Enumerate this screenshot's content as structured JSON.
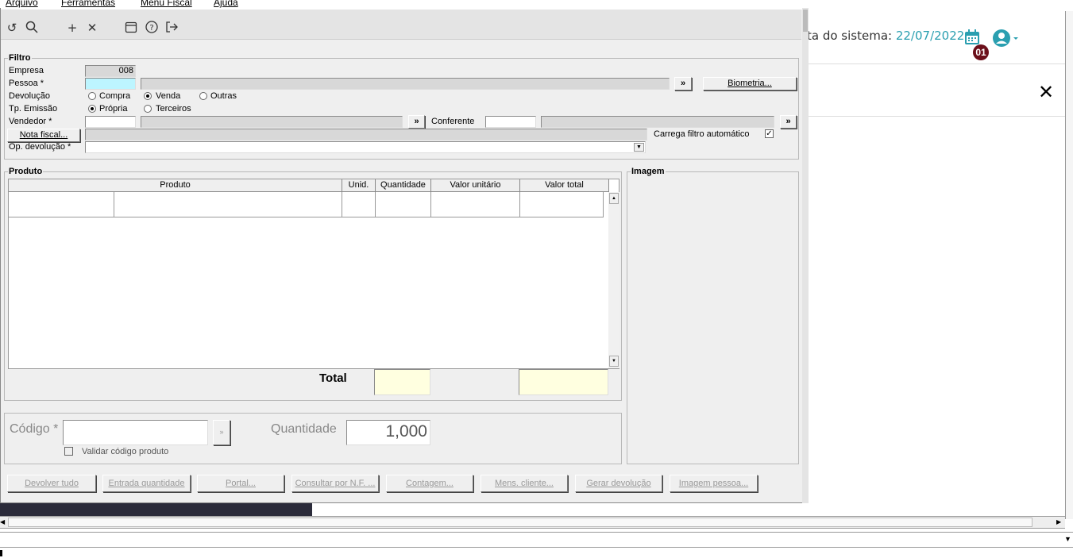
{
  "menu": {
    "items": [
      "Arquivo",
      "Ferramentas",
      "Menu Fiscal",
      "Ajuda"
    ]
  },
  "toolbar": {
    "icons": [
      "undo-icon",
      "search-icon",
      "plus-icon",
      "x-icon",
      "calendar-icon",
      "help-icon",
      "exit-icon"
    ]
  },
  "background": {
    "date_label": "ta do sistema: ",
    "date_value": "22/07/2022",
    "badge": "01",
    "close_glyph": "✕"
  },
  "filtro": {
    "legend": "Filtro",
    "empresa_label": "Empresa",
    "empresa_value": "008",
    "pessoa_label": "Pessoa *",
    "biometria_btn": "Biometria...",
    "devolucao_label": "Devolução",
    "devolucao_opts": [
      "Compra",
      "Venda",
      "Outras"
    ],
    "emissao_label": "Tp. Emissão",
    "emissao_opts": [
      "Própria",
      "Terceiros"
    ],
    "vendedor_label": "Vendedor *",
    "conferente_label": "Conferente",
    "nota_btn": "Nota fiscal...",
    "carrega_label": "Carrega filtro automático",
    "op_label": "Op. devolução *",
    "arrow_btn": "»"
  },
  "produto": {
    "legend": "Produto",
    "columns": [
      "Produto",
      "Unid.",
      "Quantidade",
      "Valor unitário",
      "Valor total"
    ],
    "total_label": "Total"
  },
  "imagem": {
    "legend": "Imagem"
  },
  "codigo": {
    "label": "Código *",
    "validar_label": "Validar código produto",
    "quantidade_label": "Quantidade",
    "quantidade_value": "1,000"
  },
  "buttons": [
    "Devolver tudo",
    "Entrada quantidade",
    "Portal...",
    "Consultar por N.F. ...",
    "Contagem...",
    "Mens. cliente...",
    "Gerar devolução",
    "Imagem pessoa..."
  ]
}
